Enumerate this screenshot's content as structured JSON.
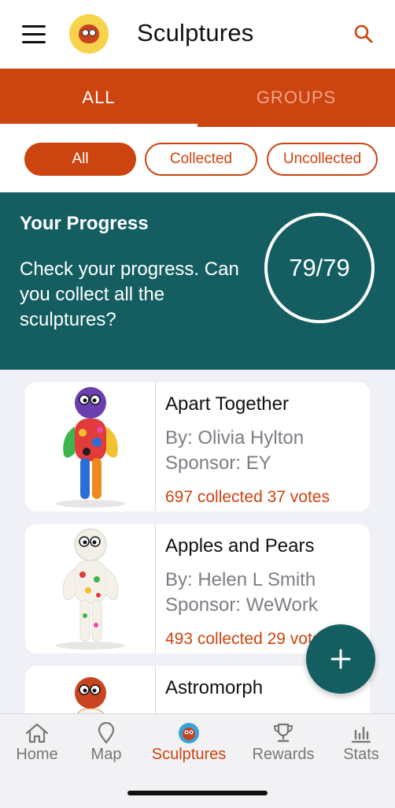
{
  "header": {
    "title": "Sculptures",
    "menu_icon": "hamburger-menu-icon",
    "search_icon": "search-icon"
  },
  "tabs": [
    {
      "label": "ALL",
      "active": true
    },
    {
      "label": "GROUPS",
      "active": false
    }
  ],
  "filters": [
    {
      "label": "All",
      "selected": true
    },
    {
      "label": "Collected",
      "selected": false
    },
    {
      "label": "Uncollected",
      "selected": false
    }
  ],
  "progress": {
    "title": "Your Progress",
    "text": "Check your progress. Can you collect all the sculptures?",
    "count": "79/79"
  },
  "sculptures": [
    {
      "name": "Apart Together",
      "by": "By: Olivia Hylton",
      "sponsor": "Sponsor: EY",
      "stats": "697 collected  37 votes"
    },
    {
      "name": "Apples and Pears",
      "by": "By: Helen L Smith",
      "sponsor": "Sponsor: WeWork",
      "stats": "493 collected  29 votes"
    },
    {
      "name": "Astromorph",
      "by": "",
      "sponsor": "",
      "stats": ""
    }
  ],
  "fab": {
    "label": "+",
    "icon": "plus-icon"
  },
  "bottom_nav": [
    {
      "label": "Home",
      "icon": "home-icon",
      "active": false
    },
    {
      "label": "Map",
      "icon": "map-pin-icon",
      "active": false
    },
    {
      "label": "Sculptures",
      "icon": "sculpture-icon",
      "active": true
    },
    {
      "label": "Rewards",
      "icon": "trophy-icon",
      "active": false
    },
    {
      "label": "Stats",
      "icon": "bar-chart-icon",
      "active": false
    }
  ],
  "colors": {
    "accent": "#cc4410",
    "teal": "#145e61",
    "background": "#f0f1f6"
  }
}
